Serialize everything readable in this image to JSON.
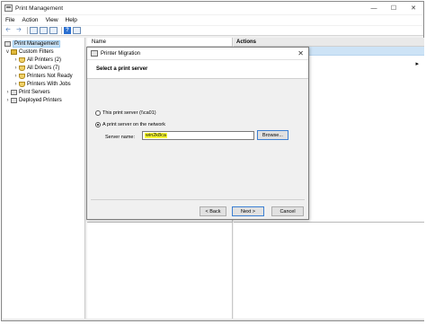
{
  "window": {
    "title": "Print Management"
  },
  "menu": [
    "File",
    "Action",
    "View",
    "Help"
  ],
  "tree": {
    "root": "Print Management",
    "custom_filters": "Custom Filters",
    "filters": [
      "All Printers (2)",
      "All Drivers (7)",
      "Printers Not Ready",
      "Printers With Jobs"
    ],
    "print_servers": "Print Servers",
    "deployed_printers": "Deployed Printers"
  },
  "center": {
    "column_header": "Name"
  },
  "actions": {
    "header": "Actions"
  },
  "dialog": {
    "title": "Printer Migration",
    "header": "Select a print server",
    "option_this": "This print server (\\\\ca01)",
    "option_network": "A print server on the network",
    "server_label": "Server name:",
    "server_value": "win2k8ca",
    "browse_label": "Browse...",
    "back_label": "< Back",
    "next_label": "Next >",
    "cancel_label": "Cancel"
  },
  "icons": {
    "app": "printer-icon",
    "minimize": "minimize-icon",
    "maximize": "maximize-icon",
    "close": "close-icon"
  }
}
